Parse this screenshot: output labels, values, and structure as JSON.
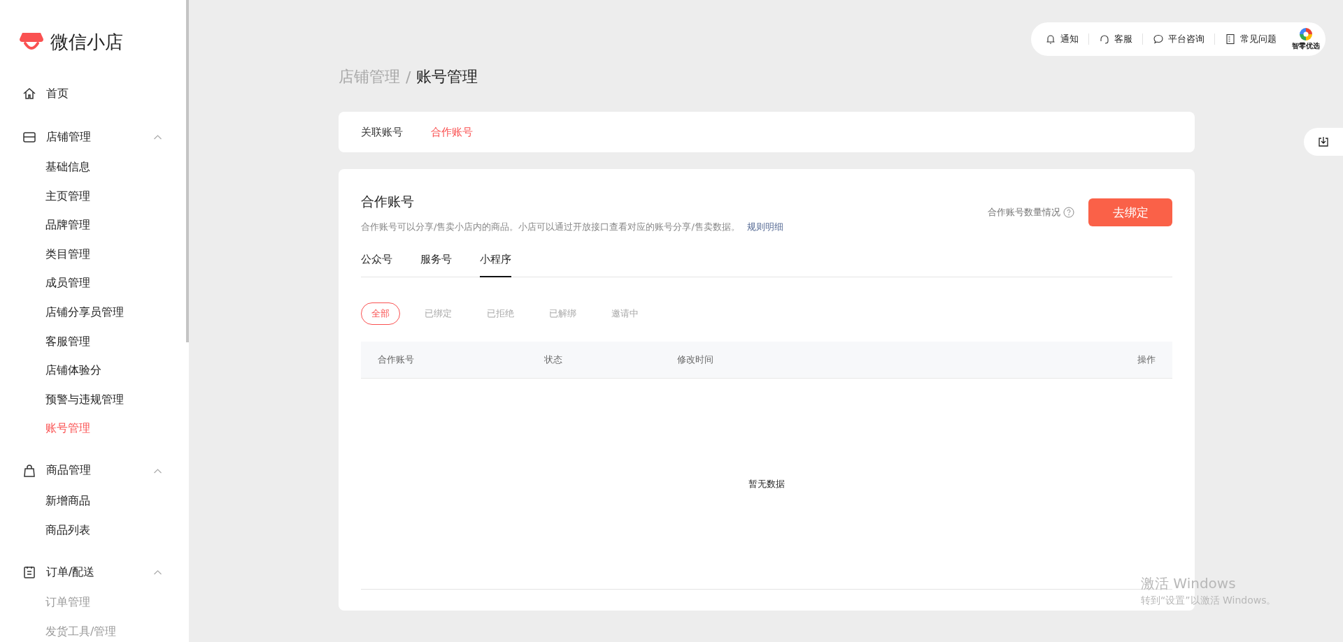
{
  "sidebar": {
    "logo": "微信小店",
    "items": [
      {
        "label": "首页",
        "selected": false
      },
      {
        "label": "店铺管理",
        "expanded": true,
        "children": [
          {
            "label": "基础信息",
            "selected": false
          },
          {
            "label": "主页管理",
            "selected": false
          },
          {
            "label": "品牌管理",
            "selected": false
          },
          {
            "label": "类目管理",
            "selected": false
          },
          {
            "label": "成员管理",
            "selected": false
          },
          {
            "label": "店铺分享员管理",
            "selected": false
          },
          {
            "label": "客服管理",
            "selected": false
          },
          {
            "label": "店铺体验分",
            "selected": false
          },
          {
            "label": "预警与违规管理",
            "selected": false
          },
          {
            "label": "账号管理",
            "selected": true
          }
        ]
      },
      {
        "label": "商品管理",
        "expanded": true,
        "children": [
          {
            "label": "新增商品",
            "selected": false
          },
          {
            "label": "商品列表",
            "selected": false
          }
        ]
      },
      {
        "label": "订单/配送",
        "expanded": true,
        "children": [
          {
            "label": "订单管理",
            "selected": false
          },
          {
            "label": "发货工具/管理",
            "selected": false
          }
        ]
      }
    ]
  },
  "topbar": {
    "items": [
      {
        "label": "通知"
      },
      {
        "label": "客服"
      },
      {
        "label": "平台咨询"
      },
      {
        "label": "常见问题"
      }
    ],
    "brand": "智零优选"
  },
  "breadcrumb": {
    "parent": "店铺管理",
    "separator": "/",
    "current": "账号管理"
  },
  "tabs": [
    {
      "label": "关联账号",
      "selected": false
    },
    {
      "label": "合作账号",
      "selected": true
    }
  ],
  "panel": {
    "title": "合作账号",
    "description": "合作账号可以分享/售卖小店内的商品。小店可以通过开放接口查看对应的账号分享/售卖数据。",
    "rules_link": "规则明细",
    "quota_label": "合作账号数量情况",
    "bind_button": "去绑定",
    "subtabs": [
      {
        "label": "公众号",
        "selected": false
      },
      {
        "label": "服务号",
        "selected": false
      },
      {
        "label": "小程序",
        "selected": true
      }
    ],
    "filters": [
      {
        "label": "全部",
        "selected": true
      },
      {
        "label": "已绑定",
        "selected": false
      },
      {
        "label": "已拒绝",
        "selected": false
      },
      {
        "label": "已解绑",
        "selected": false
      },
      {
        "label": "邀请中",
        "selected": false
      }
    ],
    "table": {
      "columns": [
        "合作账号",
        "状态",
        "修改时间",
        "操作"
      ],
      "empty_text": "暂无数据"
    }
  },
  "os_overlay": {
    "title": "激活 Windows",
    "subtitle": "转到“设置”以激活 Windows。"
  }
}
